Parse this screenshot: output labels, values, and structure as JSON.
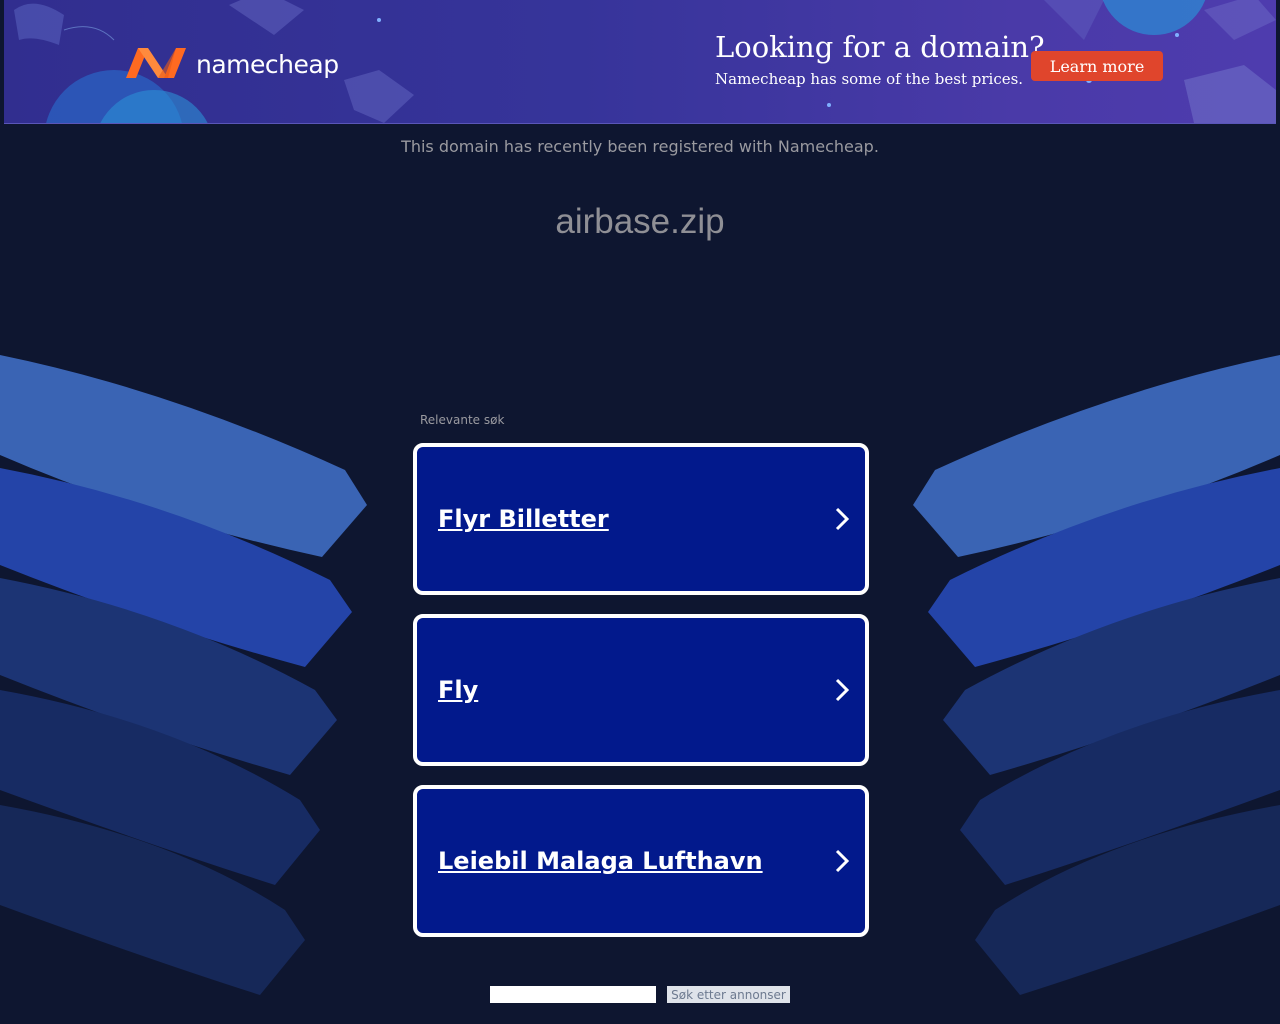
{
  "banner": {
    "logo_text": "namecheap",
    "promo_title": "Looking for a domain?",
    "promo_subtitle": "Namecheap has some of the best prices.",
    "learn_more_label": "Learn more",
    "colors": {
      "accent": "#e0452c",
      "logo_orange": "#ff6a21",
      "background": "#312e8f"
    }
  },
  "notice": "This domain has recently been registered with Namecheap.",
  "domain_name": "airbase.zip",
  "related": {
    "label": "Relevante søk",
    "links": [
      {
        "label": "Flyr Billetter"
      },
      {
        "label": "Fly"
      },
      {
        "label": "Leiebil Malaga Lufthavn"
      }
    ]
  },
  "search": {
    "input_value": "",
    "button_label": "Søk etter annonser"
  }
}
